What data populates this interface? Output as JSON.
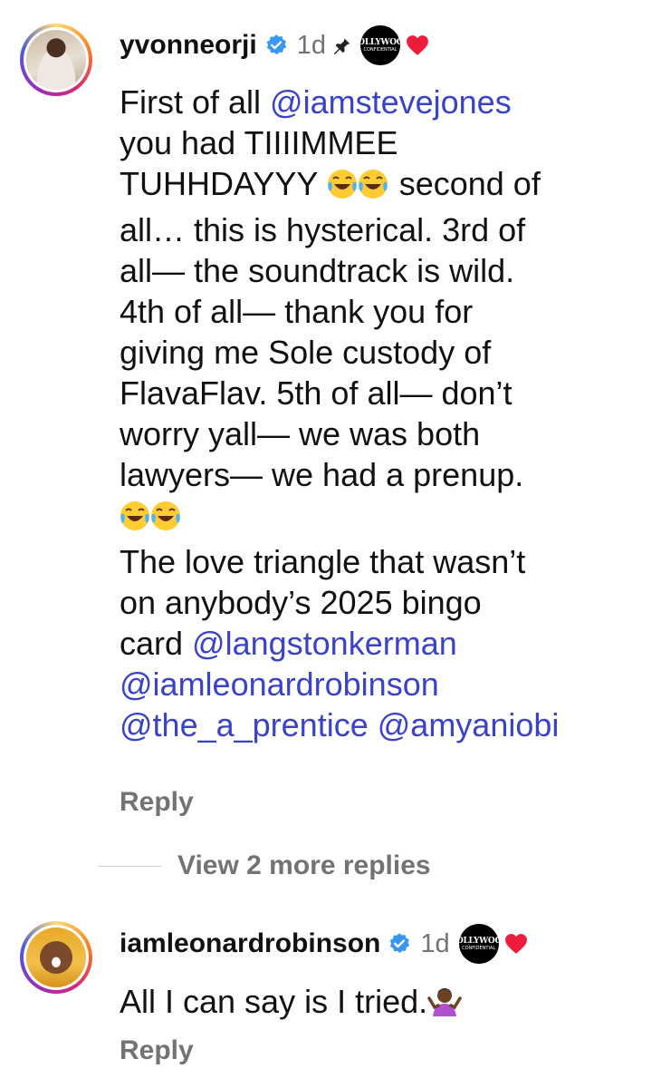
{
  "comments": [
    {
      "username": "yvonneorji",
      "time": "1d",
      "badge_top": "HOLLYWOOD",
      "badge_bottom": "CONFIDENTIAL",
      "lines": {
        "l1a": "First of all ",
        "l1m": "@iamstevejones",
        "l2": "you had TIIIIMMEE",
        "l3a": "TUHHDAYYY ",
        "l3b": " second of",
        "l4": "all… this is hysterical. 3rd of",
        "l5": "all— the soundtrack is wild.",
        "l6": "4th of all— thank you for",
        "l7": "giving me Sole custody of",
        "l8": "FlavaFlav. 5th of all— don’t",
        "l9": "worry yall— we was both",
        "l10": "lawyers— we had a prenup.",
        "l12": "The love triangle that wasn’t",
        "l13": "on anybody’s 2025 bingo",
        "l14a": "card ",
        "l14m": "@langstonkerman",
        "l15m": "@iamleonardrobinson",
        "l16m1": "@the_a_prentice",
        "l16m2": "@amyaniobi"
      },
      "reply_label": "Reply"
    },
    {
      "username": "iamleonardrobinson",
      "time": "1d",
      "badge_top": "HOLLYWOOD",
      "badge_bottom": "CONFIDENTIAL",
      "text": "All I can say is I tried.",
      "reply_label": "Reply"
    }
  ],
  "view_more_label": "View 2 more replies",
  "colors": {
    "mention": "#3a42c8",
    "muted": "#737373",
    "verified": "#3897f0",
    "heart": "#ed1c3b"
  },
  "icons": [
    "verified-badge-icon",
    "pin-icon",
    "heart-icon",
    "laughing-tears-emoji",
    "shrug-emoji"
  ]
}
